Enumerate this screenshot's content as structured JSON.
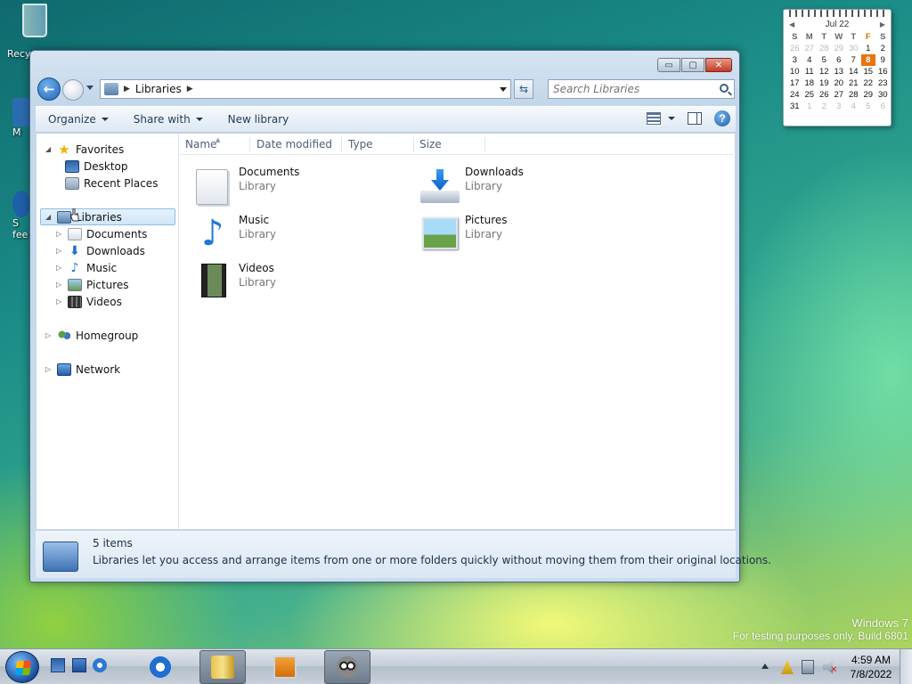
{
  "desktop": {
    "recycle_bin_label": "Recyc",
    "icon2_label": "M",
    "icon3_label_line1": "S",
    "icon3_label_line2": "fee"
  },
  "calendar": {
    "month_label": "Jul 22",
    "prev": "◀",
    "next": "▶",
    "weekdays": [
      "S",
      "M",
      "T",
      "W",
      "T",
      "F",
      "S"
    ],
    "weeks": [
      [
        "26",
        "27",
        "28",
        "29",
        "30",
        "1",
        "2"
      ],
      [
        "3",
        "4",
        "5",
        "6",
        "7",
        "8",
        "9"
      ],
      [
        "10",
        "11",
        "12",
        "13",
        "14",
        "15",
        "16"
      ],
      [
        "17",
        "18",
        "19",
        "20",
        "21",
        "22",
        "23"
      ],
      [
        "24",
        "25",
        "26",
        "27",
        "28",
        "29",
        "30"
      ],
      [
        "31",
        "1",
        "2",
        "3",
        "4",
        "5",
        "6"
      ]
    ],
    "muted": [
      [
        0,
        0
      ],
      [
        0,
        1
      ],
      [
        0,
        2
      ],
      [
        0,
        3
      ],
      [
        0,
        4
      ],
      [
        5,
        1
      ],
      [
        5,
        2
      ],
      [
        5,
        3
      ],
      [
        5,
        4
      ],
      [
        5,
        5
      ],
      [
        5,
        6
      ]
    ],
    "today": "8",
    "accent_color": "#e8740c"
  },
  "window": {
    "controls": {
      "minimize": "▭",
      "maximize": "▢",
      "close": "✕"
    },
    "address": {
      "crumb_sep": "▶",
      "crumb": "Libraries",
      "crumb_after": "▶"
    },
    "refresh_symbol": "⇆",
    "search": {
      "placeholder": "Search Libraries"
    },
    "toolbar": {
      "organize": "Organize",
      "share_with": "Share with",
      "new_library": "New library"
    },
    "nav_tree": {
      "favorites": "Favorites",
      "desktop": "Desktop",
      "recent_places": "Recent Places",
      "libraries": "Libraries",
      "documents": "Documents",
      "downloads": "Downloads",
      "music": "Music",
      "pictures": "Pictures",
      "videos": "Videos",
      "homegroup": "Homegroup",
      "network": "Network",
      "expanded_glyph": "◢",
      "collapsed_glyph": "▷",
      "star": "★",
      "down_arrow": "⬇",
      "note": "♪"
    },
    "columns": [
      "Name",
      "Date modified",
      "Type",
      "Size"
    ],
    "sort_glyph": "▲",
    "items": [
      {
        "name": "Documents",
        "sub": "Library",
        "icon": "documents-library-icon"
      },
      {
        "name": "Downloads",
        "sub": "Library",
        "icon": "downloads-library-icon"
      },
      {
        "name": "Music",
        "sub": "Library",
        "icon": "music-library-icon"
      },
      {
        "name": "Pictures",
        "sub": "Library",
        "icon": "pictures-library-icon"
      },
      {
        "name": "Videos",
        "sub": "Library",
        "icon": "videos-library-icon"
      }
    ],
    "music_glyph": "♪",
    "details": {
      "count": "5 items",
      "description": "Libraries let you access and arrange items from one or more folders quickly without moving them from their original locations."
    },
    "help_glyph": "?"
  },
  "watermark": {
    "line1": "Windows 7",
    "line2": "For testing purposes only. Build 6801"
  },
  "taskbar": {
    "clock_time": "4:59 AM",
    "clock_date": "7/8/2022",
    "volume_mute_glyph": "✕"
  }
}
